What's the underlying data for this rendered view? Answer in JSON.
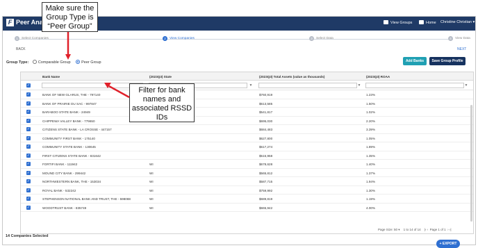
{
  "app": {
    "title": "Peer Analyt"
  },
  "nav": {
    "view_groups": "View Groups",
    "home": "Home",
    "user": "Christine Christian ▾"
  },
  "steps": [
    {
      "num": "1",
      "label": "Select Companies"
    },
    {
      "num": "2",
      "label": "View Companies"
    },
    {
      "num": "3",
      "label": "Select Data"
    },
    {
      "num": "4",
      "label": "View Data"
    }
  ],
  "back_label": "BACK",
  "next_label": "NEXT",
  "group_type": {
    "label": "Group Type:",
    "options": [
      "Comparable Group",
      "Peer Group"
    ],
    "selected": "Peer Group"
  },
  "buttons": {
    "add_banks": "Add Banks",
    "save_profile": "Save Group Profile",
    "export": "EXPORT"
  },
  "table": {
    "columns": [
      "Bank Name",
      "(2023Q3) State",
      "(2023Q3) Total Assets (value as thousands)",
      "(2023Q3) ROAA"
    ],
    "rows": [
      [
        "BANK OF NEW GLARUS, THE - 797140",
        "",
        "$760,919",
        "1.23%"
      ],
      [
        "BANK OF PRAIRIE DU SAC - 997847",
        "",
        "$613,585",
        "1.50%"
      ],
      [
        "BARABOO STATE BANK - 24949",
        "",
        "$541,817",
        "1.02%"
      ],
      [
        "CHIPPEWA VALLEY BANK - 779650",
        "",
        "$695,030",
        "2.20%"
      ],
      [
        "CITIZENS STATE BANK - LA CROSSE - 447157",
        "",
        "$684,483",
        "3.39%"
      ],
      [
        "COMMUNITY FIRST BANK - 175140",
        "",
        "$627,800",
        "1.05%"
      ],
      [
        "COMMUNITY STATE BANK - 130645",
        "",
        "$617,274",
        "1.89%"
      ],
      [
        "FIRST CITIZENS STATE BANK - 831642",
        "",
        "$515,958",
        "1.35%"
      ],
      [
        "FORTIFI BANK - 111942",
        "WI",
        "$678,628",
        "1.40%"
      ],
      [
        "MOUND CITY BANK - 299442",
        "WI",
        "$565,812",
        "1.37%"
      ],
      [
        "NORTHWESTERN BANK, THE - 153034",
        "WI",
        "$587,715",
        "1.94%"
      ],
      [
        "ROYAL BANK - 532242",
        "WI",
        "$759,992",
        "1.30%"
      ],
      [
        "STEPHENSON NATIONAL BANK AND TRUST, THE - 598088",
        "WI",
        "$689,819",
        "1.19%"
      ],
      [
        "WOODTRUST BANK - 835749",
        "WI",
        "$665,942",
        "4.00%"
      ]
    ]
  },
  "pager": {
    "page_size_label": "Page Size:",
    "page_size": "50 ▾",
    "range": "1 to 14 of 14",
    "page": "Page 1 of 1"
  },
  "footer": {
    "selected": "14 Companies Selected"
  },
  "annotations": {
    "group_type_note": [
      "Make sure the",
      "Group Type is",
      "“Peer Group”"
    ],
    "filter_note": [
      "Filter for bank",
      "names and",
      "associated RSSD",
      "IDs"
    ]
  },
  "colors": {
    "topbar": "#1f3a66",
    "accent": "#2e6fd1",
    "add_button": "#20a0b3",
    "save_button": "#16325f",
    "arrow": "#e0202a"
  }
}
